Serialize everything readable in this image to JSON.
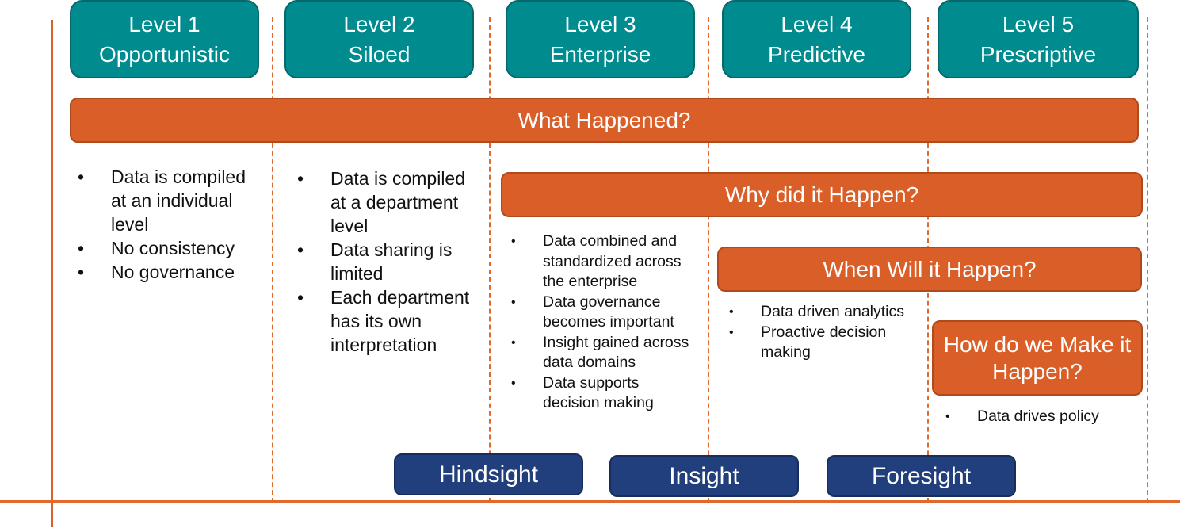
{
  "levels": [
    {
      "number": "Level 1",
      "name": "Opportunistic"
    },
    {
      "number": "Level 2",
      "name": "Siloed"
    },
    {
      "number": "Level 3",
      "name": "Enterprise"
    },
    {
      "number": "Level 4",
      "name": "Predictive"
    },
    {
      "number": "Level 5",
      "name": "Prescriptive"
    }
  ],
  "questions": {
    "what": "What Happened?",
    "why": "Why did it Happen?",
    "when": "When Will it Happen?",
    "how": "How do we Make it Happen?"
  },
  "bullets": {
    "level1": [
      "Data is compiled at an individual level",
      "No consistency",
      "No governance"
    ],
    "level2": [
      "Data is compiled at a department level",
      "Data sharing is limited",
      "Each department has its own interpretation"
    ],
    "level3": [
      "Data combined and standardized across the enterprise",
      "Data governance becomes important",
      "Insight gained across data domains",
      "Data supports decision making"
    ],
    "level4": [
      "Data driven analytics",
      "Proactive decision making"
    ],
    "level5": [
      "Data drives policy"
    ]
  },
  "sights": [
    "Hindsight",
    "Insight",
    "Foresight"
  ],
  "colors": {
    "teal": "#008B8F",
    "orange": "#DA5E27",
    "navy": "#203F7C",
    "axis": "#E0692E"
  }
}
